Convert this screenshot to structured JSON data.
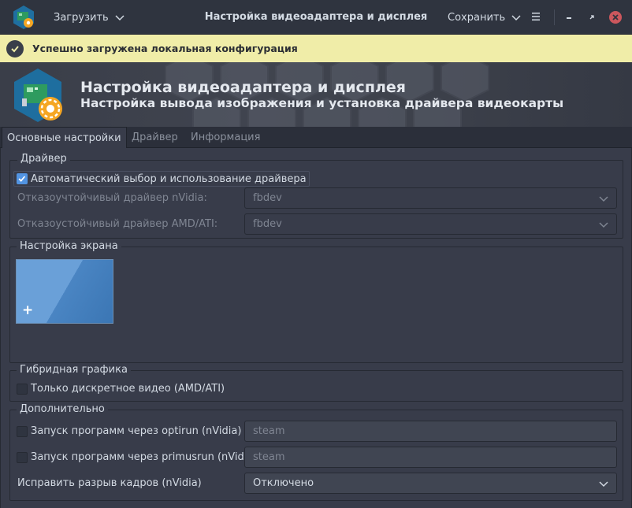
{
  "titlebar": {
    "load_label": "Загрузить",
    "title": "Настройка видеоадаптера и дисплея",
    "save_label": "Сохранить"
  },
  "infobar": {
    "message": "Успешно загружена локальная конфигурация",
    "bg_color": "#f0eda8"
  },
  "banner": {
    "title": "Настройка видеоадаптера и дисплея",
    "subtitle": "Настройка вывода изображения и установка драйвера видеокарты"
  },
  "tabs": [
    {
      "label": "Основные настройки",
      "active": true
    },
    {
      "label": "Драйвер",
      "active": false
    },
    {
      "label": "Информация",
      "active": false
    }
  ],
  "driver": {
    "title": "Драйвер",
    "auto_label": "Автоматический выбор и использование драйвера",
    "auto_checked": true,
    "nvidia_label": "Отказоучтойчивый драйвер nVidia:",
    "nvidia_value": "fbdev",
    "amd_label": "Отказоустойчивый драйвер AMD/ATI:",
    "amd_value": "fbdev"
  },
  "screen": {
    "title": "Настройка экрана",
    "add_glyph": "+"
  },
  "hybrid": {
    "title": "Гибридная графика",
    "discrete_label": "Только дискретное видео (AMD/ATI)",
    "discrete_checked": false
  },
  "advanced": {
    "title": "Дополнительно",
    "optirun_label": "Запуск программ через optirun (nVidia)",
    "optirun_checked": false,
    "optirun_value": "steam",
    "primusrun_label": "Запуск программ через primusrun (nVidia)",
    "primusrun_checked": false,
    "primusrun_value": "steam",
    "tearing_label": "Исправить разрыв кадров (nVidia)",
    "tearing_value": "Отключено"
  },
  "colors": {
    "accent": "#5294e2",
    "close": "#cc575d",
    "window_bg": "#383c4a"
  }
}
